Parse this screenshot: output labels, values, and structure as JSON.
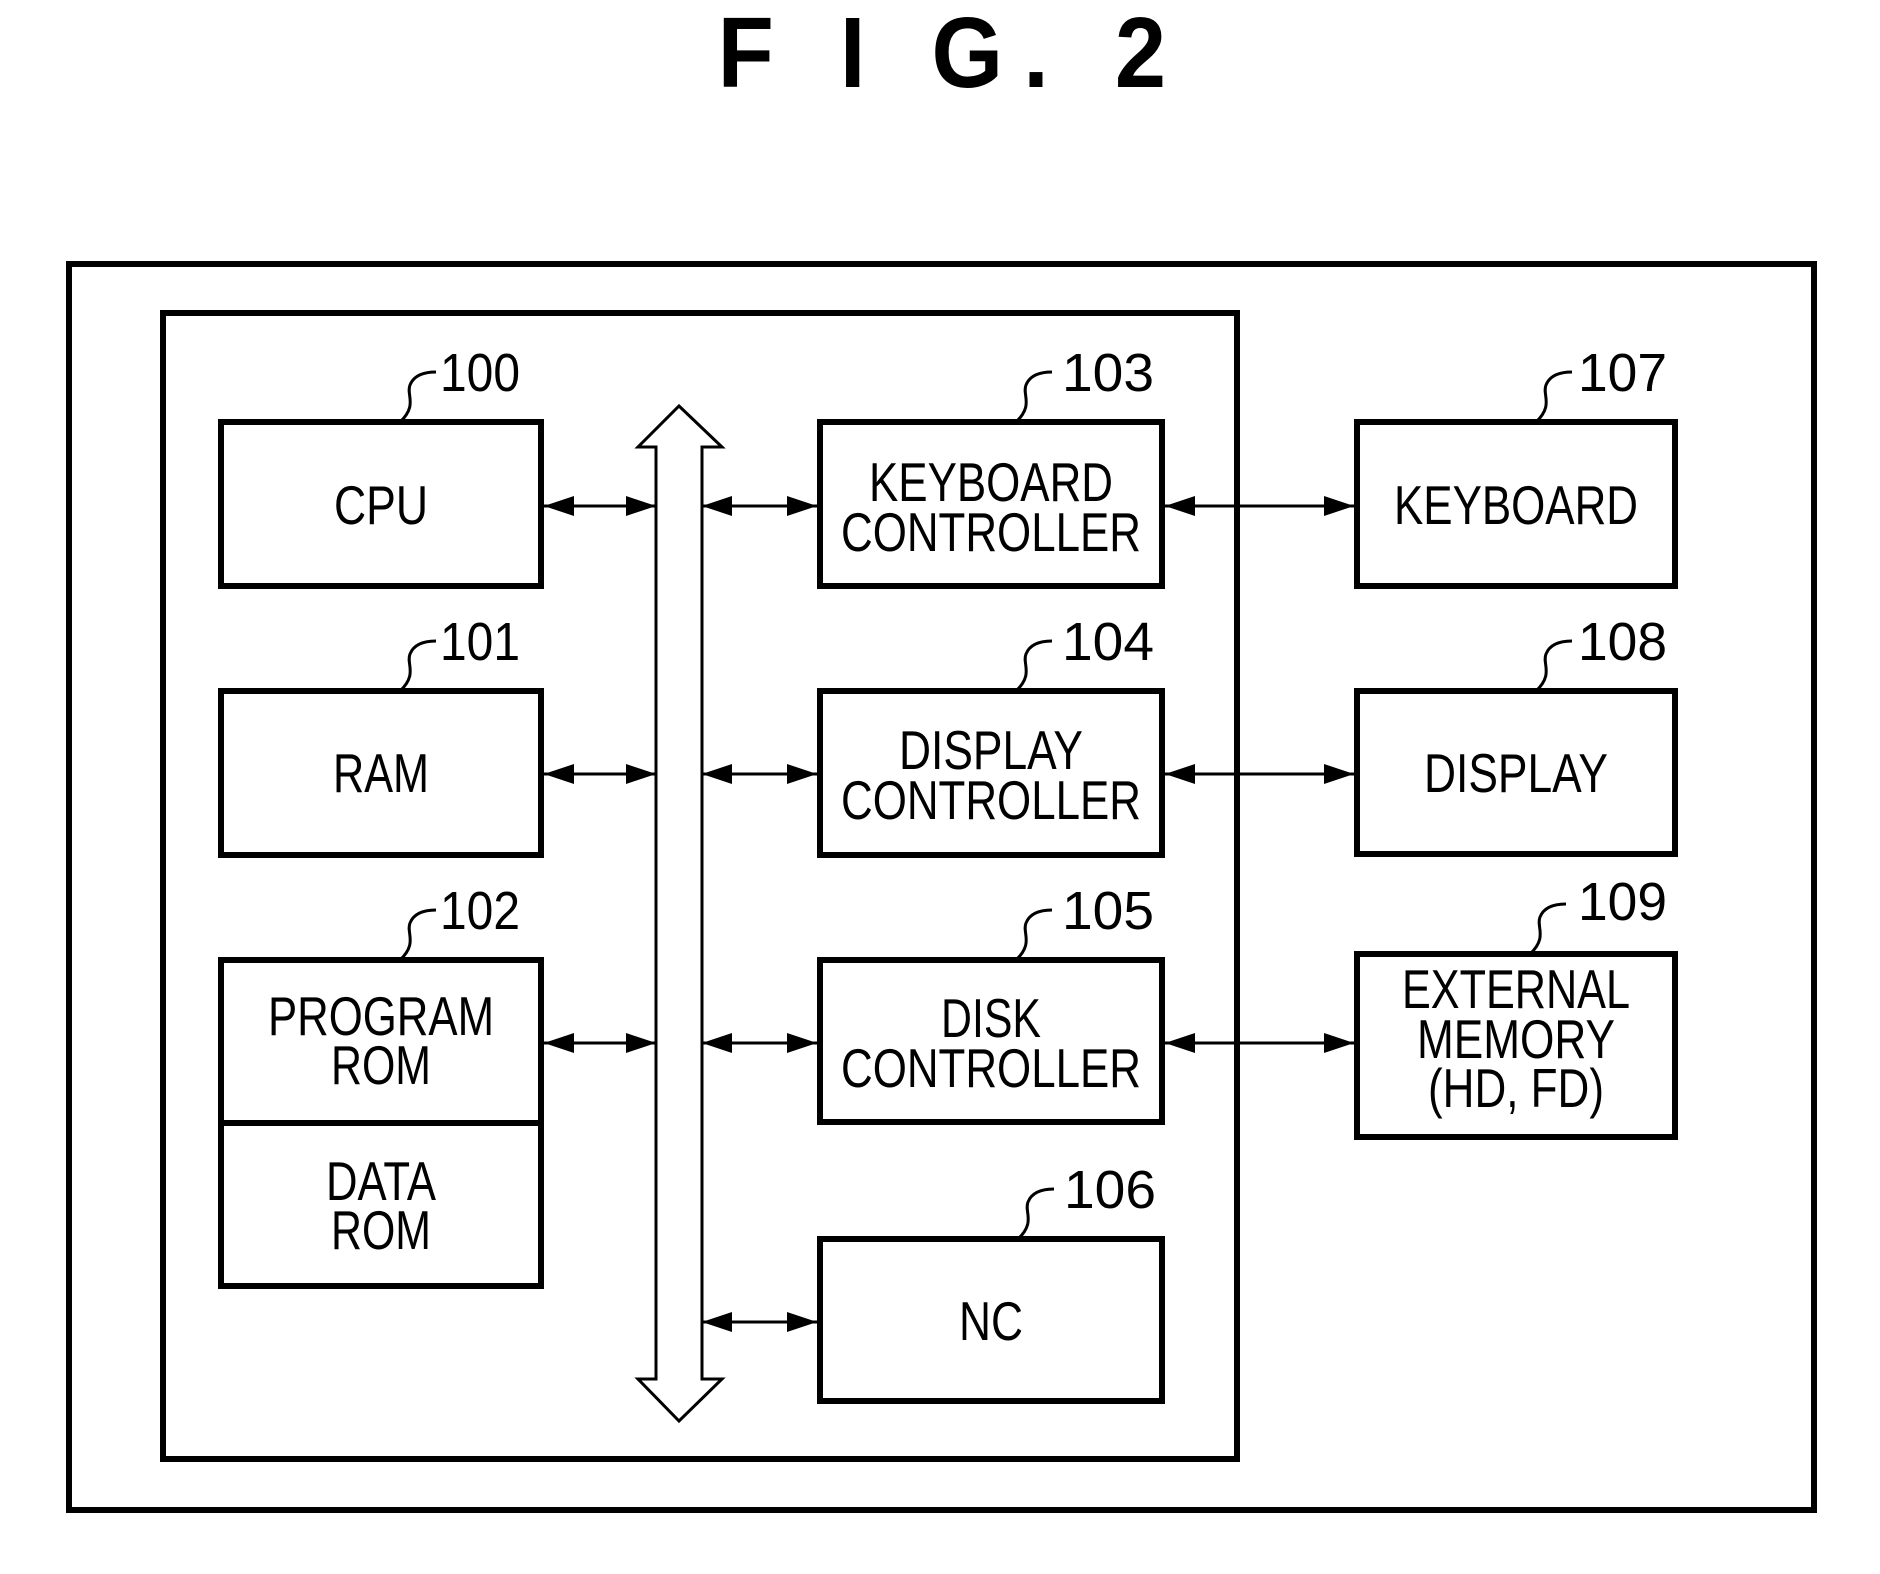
{
  "figure": {
    "title": "F I G. 2",
    "system_label": "",
    "colors": {
      "ink": "#000000",
      "paper": "#ffffff"
    }
  },
  "blocks": {
    "cpu": {
      "ref": "100",
      "lines": [
        "CPU"
      ]
    },
    "ram": {
      "ref": "101",
      "lines": [
        "RAM"
      ]
    },
    "rom": {
      "ref": "102",
      "upper": [
        "PROGRAM",
        "ROM"
      ],
      "lower": [
        "DATA",
        "ROM"
      ]
    },
    "kbc": {
      "ref": "103",
      "lines": [
        "KEYBOARD",
        "CONTROLLER"
      ]
    },
    "dispc": {
      "ref": "104",
      "lines": [
        "DISPLAY",
        "CONTROLLER"
      ]
    },
    "diskc": {
      "ref": "105",
      "lines": [
        "DISK",
        "CONTROLLER"
      ]
    },
    "nc": {
      "ref": "106",
      "lines": [
        "NC"
      ]
    },
    "kb": {
      "ref": "107",
      "lines": [
        "KEYBOARD"
      ]
    },
    "disp": {
      "ref": "108",
      "lines": [
        "DISPLAY"
      ]
    },
    "ext": {
      "ref": "109",
      "lines": [
        "EXTERNAL",
        "MEMORY",
        "(HD, FD)"
      ]
    }
  },
  "connections": [
    {
      "from": "cpu",
      "to": "system-bus",
      "type": "bidirectional"
    },
    {
      "from": "ram",
      "to": "system-bus",
      "type": "bidirectional"
    },
    {
      "from": "rom",
      "to": "system-bus",
      "type": "bidirectional"
    },
    {
      "from": "system-bus",
      "to": "kbc",
      "type": "bidirectional"
    },
    {
      "from": "system-bus",
      "to": "dispc",
      "type": "bidirectional"
    },
    {
      "from": "system-bus",
      "to": "diskc",
      "type": "bidirectional"
    },
    {
      "from": "system-bus",
      "to": "nc",
      "type": "bidirectional"
    },
    {
      "from": "kbc",
      "to": "kb",
      "type": "bidirectional"
    },
    {
      "from": "dispc",
      "to": "disp",
      "type": "bidirectional"
    },
    {
      "from": "diskc",
      "to": "ext",
      "type": "bidirectional"
    }
  ]
}
